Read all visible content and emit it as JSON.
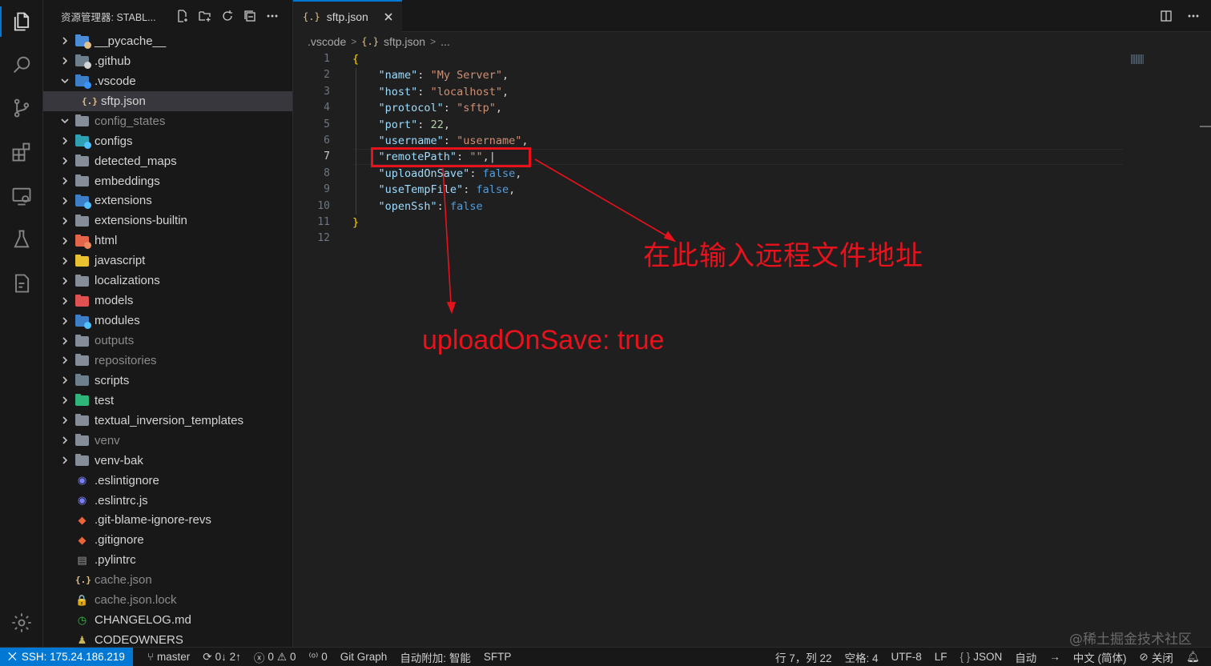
{
  "explorer": {
    "title": "资源管理器: STABL...",
    "items": [
      {
        "label": "__pycache__",
        "type": "folder",
        "color": "#4a8cd8",
        "badge": "#e2c08d",
        "state": "collapsed"
      },
      {
        "label": ".github",
        "type": "folder",
        "color": "#6d7f8c",
        "badge": "#d4d4d4",
        "state": "collapsed"
      },
      {
        "label": ".vscode",
        "type": "folder",
        "color": "#3d7ec9",
        "badge": "#3794ff",
        "state": "expanded"
      },
      {
        "label": "sftp.json",
        "type": "json",
        "selected": true
      },
      {
        "label": "config_states",
        "type": "folder",
        "color": "#858e98",
        "state": "expanded",
        "dim": true
      },
      {
        "label": "configs",
        "type": "folder",
        "color": "#2f9fb4",
        "badge": "#4fc1ff",
        "state": "collapsed"
      },
      {
        "label": "detected_maps",
        "type": "folder",
        "color": "#858e98",
        "state": "collapsed"
      },
      {
        "label": "embeddings",
        "type": "folder",
        "color": "#858e98",
        "state": "collapsed"
      },
      {
        "label": "extensions",
        "type": "folder",
        "color": "#3d7ec9",
        "badge": "#4fc1ff",
        "state": "collapsed"
      },
      {
        "label": "extensions-builtin",
        "type": "folder",
        "color": "#858e98",
        "state": "collapsed"
      },
      {
        "label": "html",
        "type": "folder",
        "color": "#e4654a",
        "badge": "#f08a5d",
        "state": "collapsed"
      },
      {
        "label": "javascript",
        "type": "folder",
        "color": "#e9c030",
        "state": "collapsed"
      },
      {
        "label": "localizations",
        "type": "folder",
        "color": "#858e98",
        "state": "collapsed"
      },
      {
        "label": "models",
        "type": "folder",
        "color": "#e05252",
        "state": "collapsed"
      },
      {
        "label": "modules",
        "type": "folder",
        "color": "#3d7ec9",
        "badge": "#4fc1ff",
        "state": "collapsed"
      },
      {
        "label": "outputs",
        "type": "folder",
        "color": "#858e98",
        "state": "collapsed",
        "dim": true
      },
      {
        "label": "repositories",
        "type": "folder",
        "color": "#858e98",
        "state": "collapsed",
        "dim": true
      },
      {
        "label": "scripts",
        "type": "folder",
        "color": "#6d7f8c",
        "state": "collapsed"
      },
      {
        "label": "test",
        "type": "folder",
        "color": "#2fb47a",
        "state": "collapsed"
      },
      {
        "label": "textual_inversion_templates",
        "type": "folder",
        "color": "#858e98",
        "state": "collapsed"
      },
      {
        "label": "venv",
        "type": "folder",
        "color": "#858e98",
        "state": "collapsed",
        "dim": true
      },
      {
        "label": "venv-bak",
        "type": "folder",
        "color": "#858e98",
        "state": "collapsed"
      },
      {
        "label": ".eslintignore",
        "type": "file",
        "glyph": "◉",
        "glyphColor": "#7b7ff5"
      },
      {
        "label": ".eslintrc.js",
        "type": "file",
        "glyph": "◉",
        "glyphColor": "#7b7ff5"
      },
      {
        "label": ".git-blame-ignore-revs",
        "type": "file",
        "glyph": "◆",
        "glyphColor": "#e8643b"
      },
      {
        "label": ".gitignore",
        "type": "file",
        "glyph": "◆",
        "glyphColor": "#e8643b"
      },
      {
        "label": ".pylintrc",
        "type": "file",
        "glyph": "▤",
        "glyphColor": "#9a9a9a"
      },
      {
        "label": "cache.json",
        "type": "json",
        "dim": true
      },
      {
        "label": "cache.json.lock",
        "type": "file",
        "glyph": "🔒",
        "glyphColor": "#e9c030",
        "dim": true
      },
      {
        "label": "CHANGELOG.md",
        "type": "file",
        "glyph": "◷",
        "glyphColor": "#3fb950"
      },
      {
        "label": "CODEOWNERS",
        "type": "file",
        "glyph": "♟",
        "glyphColor": "#c9b458"
      }
    ]
  },
  "tab": {
    "label": "sftp.json",
    "icon": "{.}"
  },
  "breadcrumb": {
    "folder": ".vscode",
    "file": "sftp.json",
    "more": "..."
  },
  "editor": {
    "current_line": 7,
    "line_numbers": [
      "1",
      "2",
      "3",
      "4",
      "5",
      "6",
      "7",
      "8",
      "9",
      "10",
      "11",
      "12"
    ],
    "lines": [
      [
        {
          "t": "{",
          "c": "br"
        }
      ],
      [
        {
          "t": "    "
        },
        {
          "t": "\"name\"",
          "c": "k"
        },
        {
          "t": ": "
        },
        {
          "t": "\"My Server\"",
          "c": "s"
        },
        {
          "t": ","
        }
      ],
      [
        {
          "t": "    "
        },
        {
          "t": "\"host\"",
          "c": "k"
        },
        {
          "t": ": "
        },
        {
          "t": "\"localhost\"",
          "c": "s"
        },
        {
          "t": ","
        }
      ],
      [
        {
          "t": "    "
        },
        {
          "t": "\"protocol\"",
          "c": "k"
        },
        {
          "t": ": "
        },
        {
          "t": "\"sftp\"",
          "c": "s"
        },
        {
          "t": ","
        }
      ],
      [
        {
          "t": "    "
        },
        {
          "t": "\"port\"",
          "c": "k"
        },
        {
          "t": ": "
        },
        {
          "t": "22",
          "c": "n"
        },
        {
          "t": ","
        }
      ],
      [
        {
          "t": "    "
        },
        {
          "t": "\"username\"",
          "c": "k"
        },
        {
          "t": ": "
        },
        {
          "t": "\"username\"",
          "c": "s"
        },
        {
          "t": ","
        }
      ],
      [
        {
          "t": "    "
        },
        {
          "t": "\"remotePath\"",
          "c": "k"
        },
        {
          "t": ": "
        },
        {
          "t": "\"\"",
          "c": "s"
        },
        {
          "t": ",|"
        }
      ],
      [
        {
          "t": "    "
        },
        {
          "t": "\"uploadOnSave\"",
          "c": "k"
        },
        {
          "t": ": "
        },
        {
          "t": "false",
          "c": "b"
        },
        {
          "t": ","
        }
      ],
      [
        {
          "t": "    "
        },
        {
          "t": "\"useTempFile\"",
          "c": "k"
        },
        {
          "t": ": "
        },
        {
          "t": "false",
          "c": "b"
        },
        {
          "t": ","
        }
      ],
      [
        {
          "t": "    "
        },
        {
          "t": "\"openSsh\"",
          "c": "k"
        },
        {
          "t": ": "
        },
        {
          "t": "false",
          "c": "b"
        }
      ],
      [
        {
          "t": "}",
          "c": "br"
        }
      ],
      [
        {
          "t": ""
        }
      ]
    ]
  },
  "annotations": {
    "remote_path_note": "在此输入远程文件地址",
    "upload_note": "uploadOnSave: true",
    "color": "#e8121c"
  },
  "watermark": "@稀土掘金技术社区",
  "status": {
    "remote": "SSH: 175.24.186.219",
    "branch": "master",
    "sync": "0↓ 2↑",
    "errors": "0",
    "warnings": "0",
    "ports": "0",
    "git_graph": "Git Graph",
    "auto_attach": "自动附加: 智能",
    "sftp": "SFTP",
    "position": "行 7，列 22",
    "spaces": "空格: 4",
    "encoding": "UTF-8",
    "eol": "LF",
    "language": "JSON",
    "auto": "自动",
    "locale": "中文 (简体)",
    "close": "关闭"
  }
}
